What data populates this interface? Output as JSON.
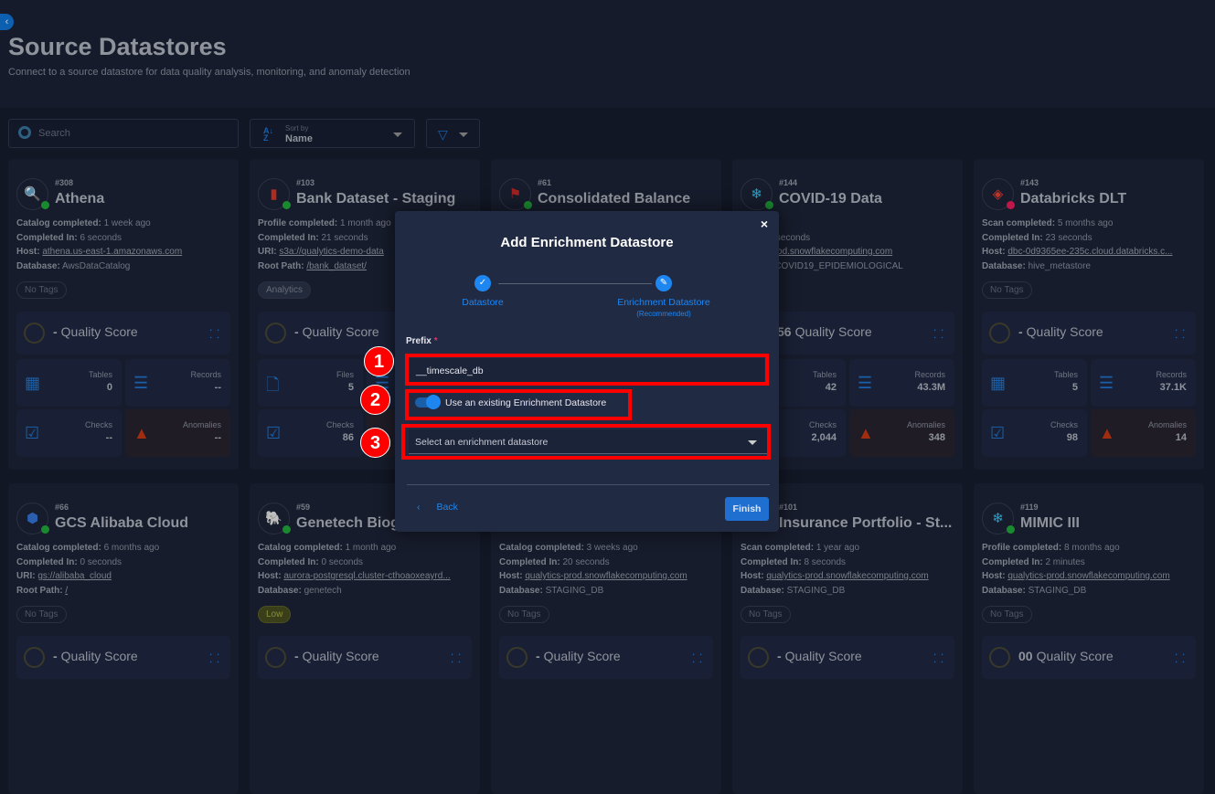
{
  "header": {
    "title": "Source Datastores",
    "subtitle": "Connect to a source datastore for data quality analysis, monitoring, and anomaly detection"
  },
  "toolbar": {
    "search_placeholder": "Search",
    "sort_label": "Sort by",
    "sort_value": "Name"
  },
  "colors": {
    "accent": "#1e86f0",
    "highlight": "#ff0000",
    "status_ok": "#1a8a2e",
    "status_error": "#c0164a",
    "anomaly": "#a12d10"
  },
  "cards": [
    {
      "id": "#308",
      "name": "Athena",
      "icon": "athena-icon",
      "status": "ok",
      "lines": [
        [
          "Catalog completed:",
          "1 week ago",
          false
        ],
        [
          "Completed In:",
          "6 seconds",
          false
        ],
        [
          "Host:",
          "athena.us-east-1.amazonaws.com",
          true
        ],
        [
          "Database:",
          "AwsDataCatalog",
          false
        ]
      ],
      "tag": "No Tags",
      "score": "-",
      "stats": [
        [
          "Tables",
          "0"
        ],
        [
          "Records",
          "--"
        ],
        [
          "Checks",
          "--"
        ],
        [
          "Anomalies",
          "--"
        ]
      ]
    },
    {
      "id": "#103",
      "name": "Bank Dataset - Staging",
      "icon": "s3-icon",
      "status": "ok",
      "lines": [
        [
          "Profile completed:",
          "1 month ago",
          false
        ],
        [
          "Completed In:",
          "21 seconds",
          false
        ],
        [
          "URI:",
          "s3a://qualytics-demo-data",
          true
        ],
        [
          "Root Path:",
          "/bank_dataset/",
          true
        ]
      ],
      "tag": "Analytics",
      "score": "-",
      "stats": [
        [
          "Files",
          "5"
        ],
        [
          "Records",
          ""
        ],
        [
          "Checks",
          "86"
        ],
        [
          "Anomalies",
          ""
        ]
      ]
    },
    {
      "id": "#61",
      "name": "Consolidated Balance",
      "icon": "redshift-icon",
      "status": "ok",
      "lines": [],
      "tag": "",
      "score": "",
      "stats": []
    },
    {
      "id": "#144",
      "name": "COVID-19 Data",
      "icon": "snowflake-icon",
      "status": "ok",
      "lines": [
        [
          "",
          "s ago",
          false
        ],
        [
          "",
          "ted In: 0 seconds",
          false
        ],
        [
          "",
          "alytics-prod.snowflakecomputing.com",
          true
        ],
        [
          "",
          "e: PUB_COVID19_EPIDEMIOLOGICAL",
          false
        ]
      ],
      "tag": "",
      "score": "56",
      "stats": [
        [
          "Tables",
          "42"
        ],
        [
          "Records",
          "43.3M"
        ],
        [
          "Checks",
          "2,044"
        ],
        [
          "Anomalies",
          "348"
        ]
      ]
    },
    {
      "id": "#143",
      "name": "Databricks DLT",
      "icon": "databricks-icon",
      "status": "error",
      "lines": [
        [
          "Scan completed:",
          "5 months ago",
          false
        ],
        [
          "Completed In:",
          "23 seconds",
          false
        ],
        [
          "Host:",
          "dbc-0d9365ee-235c.cloud.databricks.c...",
          true
        ],
        [
          "Database:",
          "hive_metastore",
          false
        ]
      ],
      "tag": "No Tags",
      "score": "-",
      "stats": [
        [
          "Tables",
          "5"
        ],
        [
          "Records",
          "37.1K"
        ],
        [
          "Checks",
          "98"
        ],
        [
          "Anomalies",
          "14"
        ]
      ]
    },
    {
      "id": "#66",
      "name": "GCS Alibaba Cloud",
      "icon": "gcs-icon",
      "status": "ok",
      "lines": [
        [
          "Catalog completed:",
          "6 months ago",
          false
        ],
        [
          "Completed In:",
          "0 seconds",
          false
        ],
        [
          "URI:",
          "gs://alibaba_cloud",
          true
        ],
        [
          "Root Path:",
          "/",
          true
        ]
      ],
      "tag": "No Tags",
      "score": "-",
      "stats": []
    },
    {
      "id": "#59",
      "name": "Genetech Biog",
      "icon": "postgresql-icon",
      "status": "ok",
      "lines": [
        [
          "Catalog completed:",
          "1 month ago",
          false
        ],
        [
          "Completed In:",
          "0 seconds",
          false
        ],
        [
          "Host:",
          "aurora-postgresql.cluster-cthoaoxeayrd...",
          true
        ],
        [
          "Database:",
          "genetech",
          false
        ]
      ],
      "tag": "Low",
      "score": "-",
      "stats": []
    },
    {
      "id": "",
      "name": "",
      "icon": "",
      "status": "",
      "lines": [
        [
          "Catalog completed:",
          "3 weeks ago",
          false
        ],
        [
          "Completed In:",
          "20 seconds",
          false
        ],
        [
          "Host:",
          "qualytics-prod.snowflakecomputing.com",
          true
        ],
        [
          "Database:",
          "STAGING_DB",
          false
        ]
      ],
      "tag": "No Tags",
      "score": "-",
      "stats": []
    },
    {
      "id": "#101",
      "name": "Insurance Portfolio - St...",
      "icon": "",
      "status": "",
      "lines": [
        [
          "Scan completed:",
          "1 year ago",
          false
        ],
        [
          "Completed In:",
          "8 seconds",
          false
        ],
        [
          "Host:",
          "qualytics-prod.snowflakecomputing.com",
          true
        ],
        [
          "Database:",
          "STAGING_DB",
          false
        ]
      ],
      "tag": "No Tags",
      "score": "-",
      "stats": []
    },
    {
      "id": "#119",
      "name": "MIMIC III",
      "icon": "snowflake-icon",
      "status": "ok",
      "lines": [
        [
          "Profile completed:",
          "8 months ago",
          false
        ],
        [
          "Completed In:",
          "2 minutes",
          false
        ],
        [
          "Host:",
          "qualytics-prod.snowflakecomputing.com",
          true
        ],
        [
          "Database:",
          "STAGING_DB",
          false
        ]
      ],
      "tag": "No Tags",
      "score": "00",
      "stats": []
    }
  ],
  "quality_label": "Quality Score",
  "modal": {
    "title": "Add Enrichment Datastore",
    "close": "×",
    "steps": [
      {
        "label": "Datastore",
        "sub": ""
      },
      {
        "label": "Enrichment Datastore",
        "sub": "(Recommended)"
      }
    ],
    "prefix_label": "Prefix",
    "required_mark": "*",
    "prefix_value": "__timescale_db",
    "toggle_label": "Use an existing Enrichment Datastore",
    "toggle_on": true,
    "select_placeholder": "Select an enrichment datastore",
    "back": "Back",
    "finish": "Finish"
  },
  "annotations": [
    "1",
    "2",
    "3"
  ]
}
